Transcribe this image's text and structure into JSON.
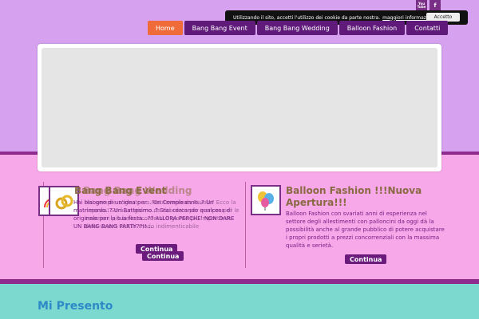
{
  "cookie": {
    "text": "Utilizzando il sito, accetti l'utilizzo dei cookie da parte nostra.",
    "link": "maggiori informazioni",
    "accept_label": "Accetto"
  },
  "social": {
    "youtube": "You Tube",
    "facebook": "f"
  },
  "nav": {
    "home": "Home",
    "event": "Bang Bang Event",
    "wedding": "Bang Bang Wedding",
    "balloon": "Balloon Fashion",
    "contatti": "Contatti"
  },
  "col1": {
    "title_a": "Bang Bang Event",
    "title_b": "Bang Bang Wedding",
    "text_a": "Hai bisogno di un'idea per... Un Compleanno..? Un matrimonio..? Un Battesimo..? Stai cercando qualcosa di originale per la tua festa...?? ALLORA PERCHE' NON DARE UN BANG BANG PARTY??!!....",
    "text_b": "Hai sempre sognato un Matrimonio da Favola? Ecco la risposta! Sarà un giorno da ricordare per sempre per le emozioni più belle ricorderai il giorno più importante della vostra vita in modo indimenticabile",
    "button_a": "Continua",
    "button_b": "Continua"
  },
  "col2": {
    "title": "Balloon Fashion !!!Nuova Apertura!!!",
    "text": "Balloon Fashion con svariati anni di esperienza nel settore degli allestimenti con palloncini da oggi dà la possibilità anche al grande pubblico di potere acquistare i propri prodotti a prezzi concorrenziali con la massima qualità e serietà.",
    "button": "Continua"
  },
  "section": {
    "title": "Mi Presento"
  }
}
